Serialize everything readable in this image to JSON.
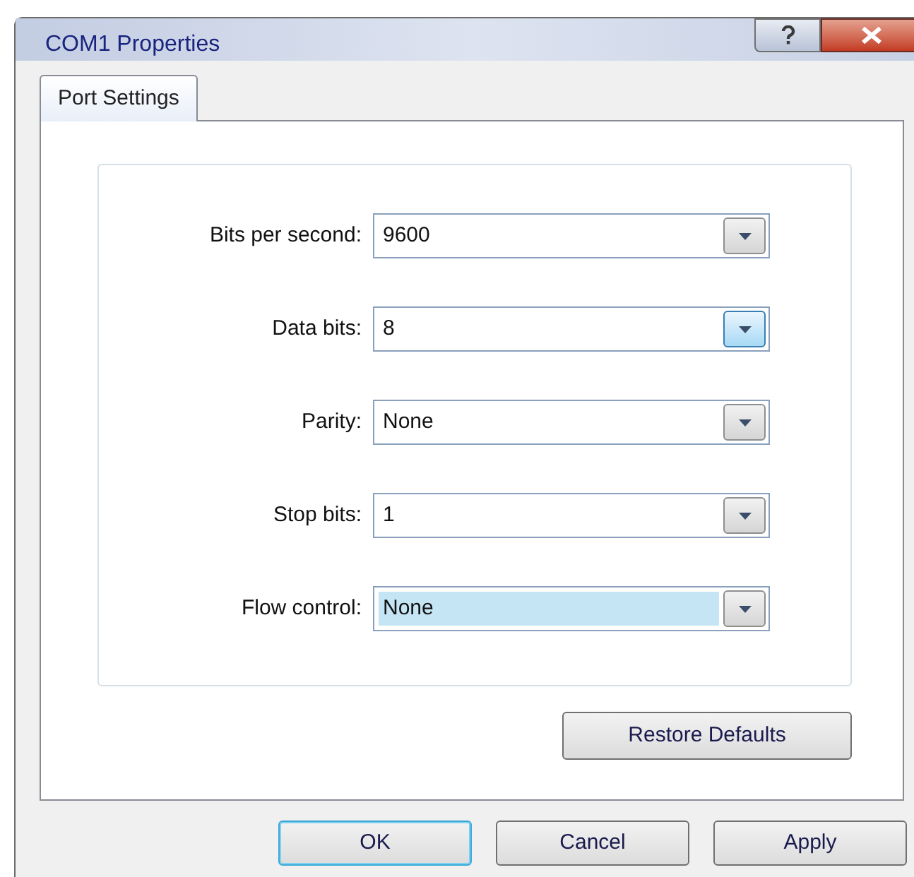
{
  "window": {
    "title": "COM1 Properties"
  },
  "tabs": [
    {
      "label": "Port Settings",
      "selected": true
    }
  ],
  "fields": [
    {
      "label": "Bits per second:",
      "value": "9600",
      "value_highlighted": false,
      "arrow_hover": false
    },
    {
      "label": "Data bits:",
      "value": "8",
      "value_highlighted": false,
      "arrow_hover": true
    },
    {
      "label": "Parity:",
      "value": "None",
      "value_highlighted": false,
      "arrow_hover": false
    },
    {
      "label": "Stop bits:",
      "value": "1",
      "value_highlighted": false,
      "arrow_hover": false
    },
    {
      "label": "Flow control:",
      "value": "None",
      "value_highlighted": true,
      "arrow_hover": false
    }
  ],
  "restore_button": "Restore Defaults",
  "buttons": [
    {
      "label": "OK",
      "default": true
    },
    {
      "label": "Cancel",
      "default": false
    },
    {
      "label": "Apply",
      "default": false
    }
  ]
}
